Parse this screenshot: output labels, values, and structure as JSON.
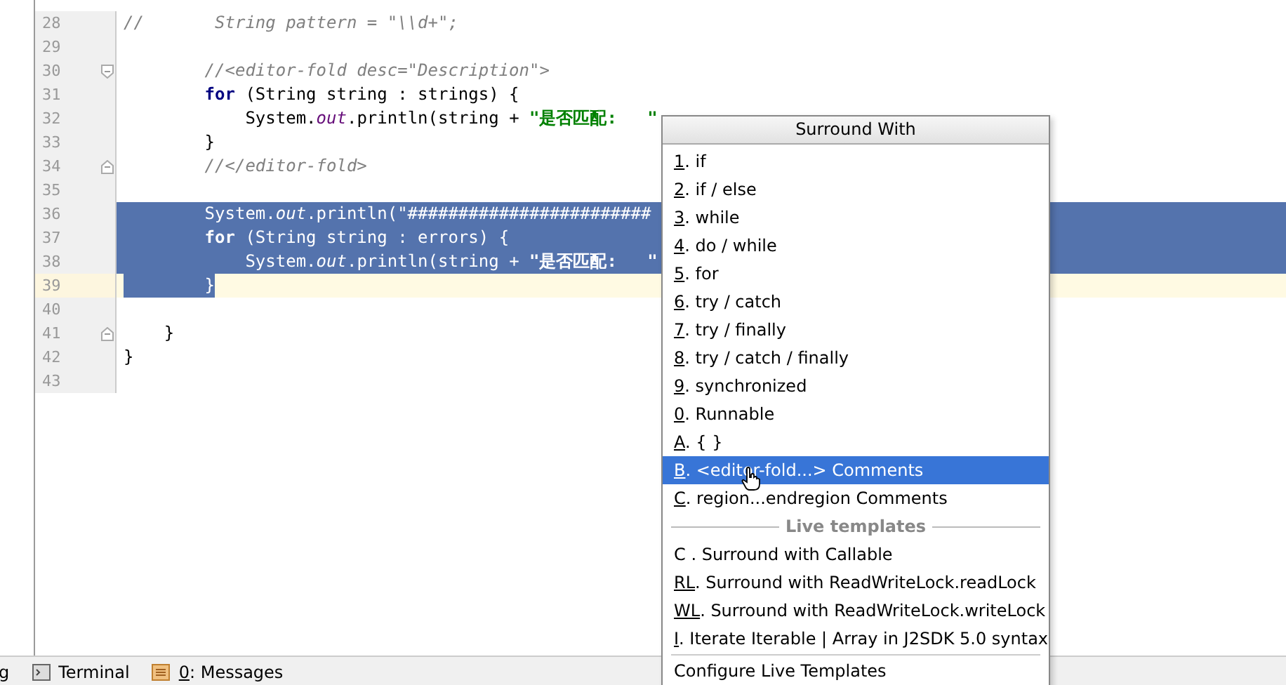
{
  "editor": {
    "lines": [
      {
        "number": "28",
        "selected": false,
        "current": false,
        "tokens": [
          {
            "kind": "comment",
            "text": "//       String pattern = \"\\\\d+\";"
          }
        ]
      },
      {
        "number": "29",
        "selected": false,
        "current": false
      },
      {
        "number": "30",
        "selected": false,
        "current": false,
        "fold_start": true,
        "tokens": [
          {
            "kind": "comment",
            "text": "        //<editor-fold desc=\"Description\">"
          }
        ]
      },
      {
        "number": "31",
        "selected": false,
        "current": false,
        "tokens": [
          {
            "kind": "kw",
            "text": "        for"
          },
          {
            "kind": "plain",
            "text": " (String string : strings) {"
          }
        ]
      },
      {
        "number": "32",
        "selected": false,
        "current": false,
        "tokens": [
          {
            "kind": "plain",
            "text": "            System."
          },
          {
            "kind": "field",
            "text": "out"
          },
          {
            "kind": "plain",
            "text": ".println(string + "
          },
          {
            "kind": "str",
            "text": "\"是否匹配:   \""
          }
        ]
      },
      {
        "number": "33",
        "selected": false,
        "current": false,
        "tokens": [
          {
            "kind": "plain",
            "text": "        }"
          }
        ]
      },
      {
        "number": "34",
        "selected": false,
        "current": false,
        "fold_end": true,
        "tokens": [
          {
            "kind": "comment",
            "text": "        //</editor-fold>"
          }
        ]
      },
      {
        "number": "35",
        "selected": false,
        "current": false
      },
      {
        "number": "36",
        "selected": true,
        "current": false,
        "tokens": [
          {
            "kind": "plain",
            "text": "        System."
          },
          {
            "kind": "field",
            "text": "out"
          },
          {
            "kind": "plain",
            "text": ".println(\"########################"
          }
        ]
      },
      {
        "number": "37",
        "selected": true,
        "current": false,
        "tokens": [
          {
            "kind": "kw",
            "text": "        for"
          },
          {
            "kind": "plain",
            "text": " (String string : errors) {"
          }
        ]
      },
      {
        "number": "38",
        "selected": true,
        "current": false,
        "tokens": [
          {
            "kind": "plain",
            "text": "            System."
          },
          {
            "kind": "field",
            "text": "out"
          },
          {
            "kind": "plain",
            "text": ".println(string + "
          },
          {
            "kind": "str",
            "text": "\"是否匹配:   \""
          }
        ]
      },
      {
        "number": "39",
        "selected": true,
        "current": true,
        "tokens": [
          {
            "kind": "plain",
            "text": "        }"
          }
        ]
      },
      {
        "number": "40",
        "selected": false,
        "current": false
      },
      {
        "number": "41",
        "selected": false,
        "current": false,
        "fold_end": true,
        "tokens": [
          {
            "kind": "plain",
            "text": "    }"
          }
        ]
      },
      {
        "number": "42",
        "selected": false,
        "current": false,
        "tokens": [
          {
            "kind": "plain",
            "text": "}"
          }
        ]
      },
      {
        "number": "43",
        "selected": false,
        "current": false
      }
    ]
  },
  "popup": {
    "title": "Surround With",
    "items": [
      {
        "kind": "item",
        "mnemonic": "1",
        "text": ". if",
        "selected": false
      },
      {
        "kind": "item",
        "mnemonic": "2",
        "text": ". if / else",
        "selected": false
      },
      {
        "kind": "item",
        "mnemonic": "3",
        "text": ". while",
        "selected": false
      },
      {
        "kind": "item",
        "mnemonic": "4",
        "text": ". do / while",
        "selected": false
      },
      {
        "kind": "item",
        "mnemonic": "5",
        "text": ". for",
        "selected": false
      },
      {
        "kind": "item",
        "mnemonic": "6",
        "text": ". try / catch",
        "selected": false
      },
      {
        "kind": "item",
        "mnemonic": "7",
        "text": ". try / finally",
        "selected": false
      },
      {
        "kind": "item",
        "mnemonic": "8",
        "text": ". try / catch / finally",
        "selected": false
      },
      {
        "kind": "item",
        "mnemonic": "9",
        "text": ". synchronized",
        "selected": false
      },
      {
        "kind": "item",
        "mnemonic": "0",
        "text": ". Runnable",
        "selected": false
      },
      {
        "kind": "item",
        "mnemonic": "A",
        "text": ". { }",
        "selected": false
      },
      {
        "kind": "item",
        "mnemonic": "B",
        "text": ". <editor-fold...> Comments",
        "selected": true
      },
      {
        "kind": "item",
        "mnemonic": "C",
        "text": ". region...endregion Comments",
        "selected": false
      },
      {
        "kind": "separator",
        "text": "Live templates"
      },
      {
        "kind": "item",
        "text": "C . Surround with Callable",
        "selected": false
      },
      {
        "kind": "item",
        "mnemonic": "RL",
        "text": ". Surround with ReadWriteLock.readLock",
        "selected": false
      },
      {
        "kind": "item",
        "mnemonic": "WL",
        "text": ". Surround with ReadWriteLock.writeLock",
        "selected": false
      },
      {
        "kind": "item",
        "mnemonic": "I",
        "text": ". Iterate Iterable | Array in J2SDK 5.0 syntax",
        "selected": false
      },
      {
        "kind": "rule"
      },
      {
        "kind": "item",
        "text": "Configure Live Templates",
        "selected": false
      }
    ]
  },
  "bottom_bar": {
    "items": [
      {
        "kind": "plain",
        "text": "g"
      },
      {
        "kind": "terminal",
        "text": "Terminal"
      },
      {
        "kind": "messages",
        "mnemonic": "0",
        "text": ": Messages"
      }
    ]
  }
}
